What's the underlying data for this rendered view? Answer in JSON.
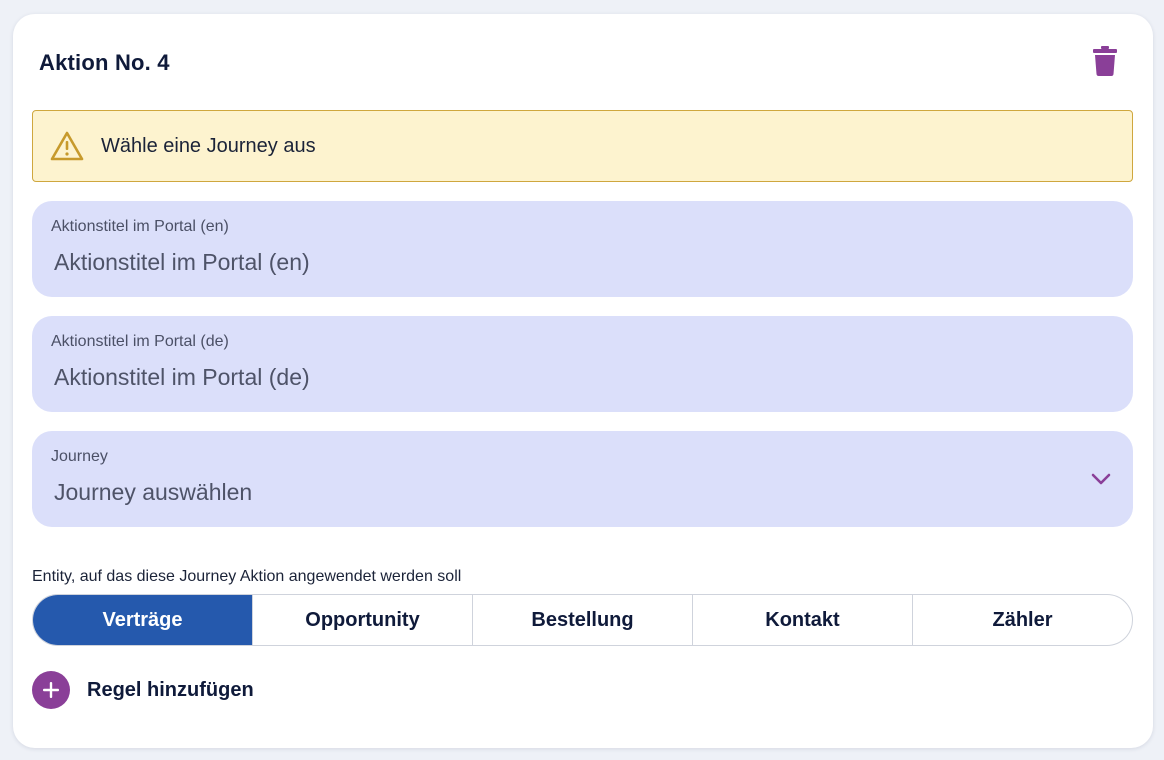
{
  "card": {
    "title": "Aktion No. 4"
  },
  "alert": {
    "message": "Wähle eine Journey aus"
  },
  "fields": {
    "title_en": {
      "label": "Aktionstitel im Portal (en)",
      "placeholder": "Aktionstitel im Portal (en)",
      "value": ""
    },
    "title_de": {
      "label": "Aktionstitel im Portal (de)",
      "placeholder": "Aktionstitel im Portal (de)",
      "value": ""
    },
    "journey": {
      "label": "Journey",
      "selected": "Journey auswählen"
    }
  },
  "entity": {
    "label": "Entity, auf das diese Journey Aktion angewendet werden soll",
    "options": [
      "Verträge",
      "Opportunity",
      "Bestellung",
      "Kontakt",
      "Zähler"
    ],
    "selected": "Verträge"
  },
  "add_rule": {
    "label": "Regel hinzufügen"
  },
  "icons": {
    "delete": "trash-icon",
    "alert": "warning-triangle-icon",
    "select": "chevron-down-icon",
    "add": "plus-icon"
  },
  "colors": {
    "accent_purple": "#8a3f98",
    "active_segment": "#2559ad",
    "field_bg": "#dbdffa",
    "alert_bg": "#fdf3cf",
    "alert_border": "#cfa73e"
  }
}
